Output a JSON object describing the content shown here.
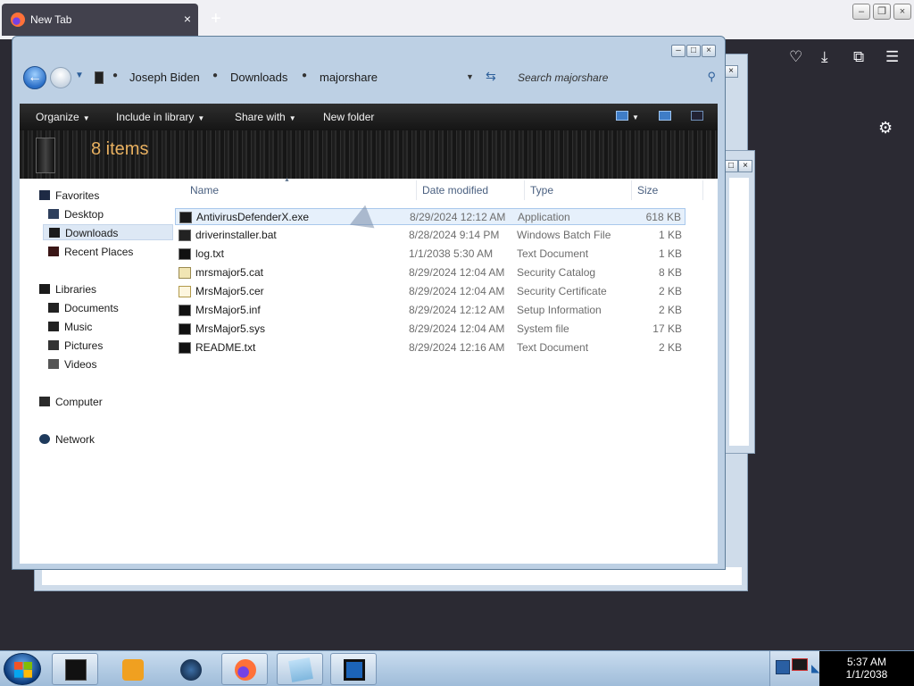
{
  "browser": {
    "tab_title": "New Tab",
    "tab_close": "×",
    "new_tab": "+",
    "toolbar_icons": [
      "pocket-icon",
      "download-icon",
      "extensions-icon",
      "menu-icon"
    ]
  },
  "explorer": {
    "caption_buttons": [
      "–",
      "□",
      "×"
    ],
    "breadcrumb": [
      "Joseph Biden",
      "Downloads",
      "majorshare"
    ],
    "search_placeholder": "Search majorshare",
    "commands": {
      "organize": "Organize",
      "include_in_library": "Include in library",
      "share_with": "Share with",
      "new_folder": "New folder"
    },
    "items_count": "8 items",
    "nav": {
      "favorites": "Favorites",
      "desktop": "Desktop",
      "downloads": "Downloads",
      "recent_places": "Recent Places",
      "libraries": "Libraries",
      "documents": "Documents",
      "music": "Music",
      "pictures": "Pictures",
      "videos": "Videos",
      "computer": "Computer",
      "network": "Network"
    },
    "columns": {
      "name": "Name",
      "date_modified": "Date modified",
      "type": "Type",
      "size": "Size"
    },
    "files": [
      {
        "name": "AntivirusDefenderX.exe",
        "date": "8/29/2024 12:12 AM",
        "type": "Application",
        "size": "618 KB",
        "icon": "application-icon"
      },
      {
        "name": "driverinstaller.bat",
        "date": "8/28/2024 9:14 PM",
        "type": "Windows Batch File",
        "size": "1 KB",
        "icon": "batch-file-icon"
      },
      {
        "name": "log.txt",
        "date": "1/1/2038 5:30 AM",
        "type": "Text Document",
        "size": "1 KB",
        "icon": "text-file-icon"
      },
      {
        "name": "mrsmajor5.cat",
        "date": "8/29/2024 12:04 AM",
        "type": "Security Catalog",
        "size": "8 KB",
        "icon": "catalog-icon"
      },
      {
        "name": "MrsMajor5.cer",
        "date": "8/29/2024 12:04 AM",
        "type": "Security Certificate",
        "size": "2 KB",
        "icon": "certificate-icon"
      },
      {
        "name": "MrsMajor5.inf",
        "date": "8/29/2024 12:12 AM",
        "type": "Setup Information",
        "size": "2 KB",
        "icon": "setup-info-icon"
      },
      {
        "name": "MrsMajor5.sys",
        "date": "8/29/2024 12:04 AM",
        "type": "System file",
        "size": "17 KB",
        "icon": "system-file-icon"
      },
      {
        "name": "README.txt",
        "date": "8/29/2024 12:16 AM",
        "type": "Text Document",
        "size": "2 KB",
        "icon": "text-file-icon"
      }
    ]
  },
  "taskbar": {
    "pinned": [
      "explorer-app-icon",
      "media-player-icon",
      "globe-app-icon",
      "firefox-icon",
      "notepad-icon",
      "monitor-app-icon"
    ],
    "time": "5:37 AM",
    "date": "1/1/2038"
  },
  "colors": {
    "items_count_text": "#e8b060",
    "selection": "#e6f0fb",
    "command_bar": "#1f1f1f"
  }
}
